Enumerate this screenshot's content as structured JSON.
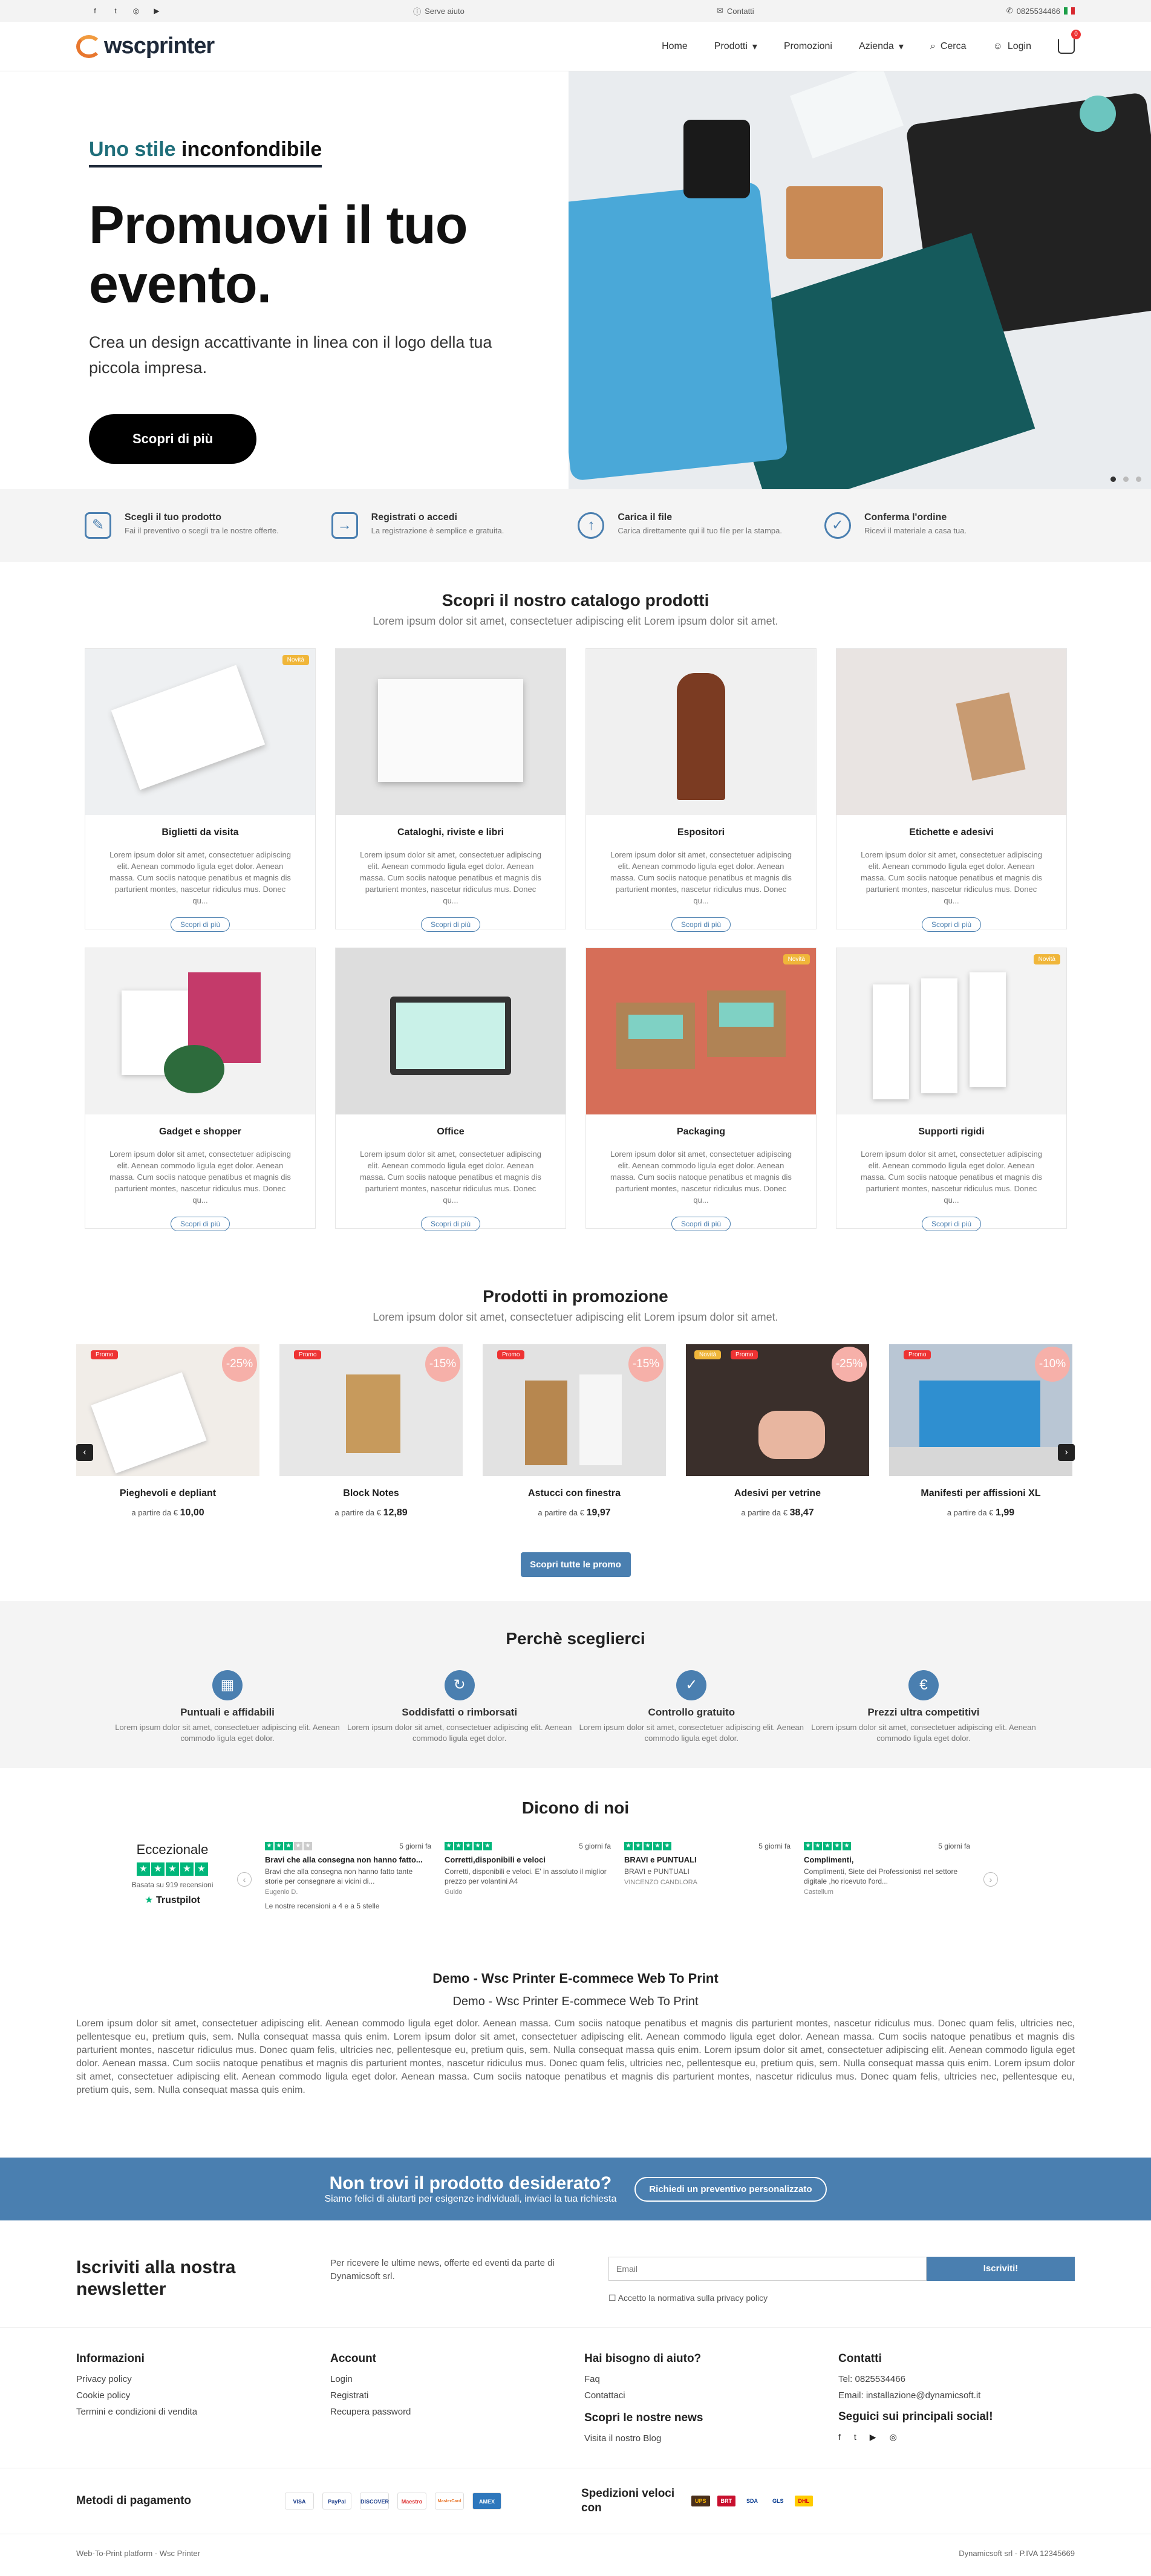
{
  "topbar": {
    "help": "Serve aiuto",
    "contacts": "Contatti",
    "phone": "0825534466"
  },
  "header": {
    "logo": "wscprinter",
    "nav": [
      "Home",
      "Prodotti",
      "Promozioni",
      "Azienda",
      "Cerca",
      "Login"
    ],
    "cart_count": "0"
  },
  "hero": {
    "kicker_1": "Uno stile",
    "kicker_2": "inconfondibile",
    "title": "Promuovi il tuo evento.",
    "text": "Crea un design accattivante in linea con il logo della tua piccola impresa.",
    "button": "Scopri di più"
  },
  "steps": [
    {
      "title": "Scegli il tuo prodotto",
      "text": "Fai il preventivo o scegli tra le nostre offerte."
    },
    {
      "title": "Registrati o accedi",
      "text": "La registrazione è semplice e gratuita."
    },
    {
      "title": "Carica il file",
      "text": "Carica direttamente qui il tuo file per la stampa."
    },
    {
      "title": "Conferma l'ordine",
      "text": "Ricevi il materiale a casa tua."
    }
  ],
  "catalog": {
    "title": "Scopri il nostro catalogo prodotti",
    "subtitle": "Lorem ipsum dolor sit amet, consectetuer adipiscing elit Lorem ipsum dolor sit amet.",
    "desc": "Lorem ipsum dolor sit amet, consectetuer adipiscing elit. Aenean commodo ligula eget dolor. Aenean massa. Cum sociis natoque penatibus et magnis dis parturient montes, nascetur ridiculus mus. Donec qu...",
    "more": "Scopri di più",
    "tag": "Novità",
    "items": [
      {
        "name": "Biglietti da visita"
      },
      {
        "name": "Cataloghi, riviste e libri"
      },
      {
        "name": "Espositori"
      },
      {
        "name": "Etichette e adesivi"
      },
      {
        "name": "Gadget e shopper"
      },
      {
        "name": "Office"
      },
      {
        "name": "Packaging"
      },
      {
        "name": "Supporti rigidi"
      }
    ]
  },
  "promo": {
    "title": "Prodotti in promozione",
    "subtitle": "Lorem ipsum dolor sit amet, consectetuer adipiscing elit Lorem ipsum dolor sit amet.",
    "price_prefix": "a partire da €",
    "promo_tag": "Promo",
    "new_tag": "Novità",
    "button": "Scopri tutte le promo",
    "items": [
      {
        "name": "Pieghevoli e depliant",
        "price": "10,00",
        "discount": "-25%"
      },
      {
        "name": "Block Notes",
        "price": "12,89",
        "discount": "-15%"
      },
      {
        "name": "Astucci con finestra",
        "price": "19,97",
        "discount": "-15%"
      },
      {
        "name": "Adesivi per vetrine",
        "price": "38,47",
        "discount": "-25%"
      },
      {
        "name": "Manifesti per affissioni XL",
        "price": "1,99",
        "discount": "-10%"
      }
    ]
  },
  "why": {
    "title": "Perchè sceglierci",
    "desc": "Lorem ipsum dolor sit amet, consectetuer adipiscing elit. Aenean commodo ligula eget dolor.",
    "items": [
      {
        "title": "Puntuali e affidabili"
      },
      {
        "title": "Soddisfatti o rimborsati"
      },
      {
        "title": "Controllo gratuito"
      },
      {
        "title": "Prezzi ultra competitivi"
      }
    ]
  },
  "reviews": {
    "title": "Dicono di noi",
    "rating": "Eccezionale",
    "based": "Basata su 919 recensioni",
    "trustpilot": "Trustpilot",
    "footer": "Le nostre recensioni a 4 e a 5 stelle",
    "items": [
      {
        "when": "5 giorni fa",
        "title": "Bravi che alla consegna non hanno fatto...",
        "body": "Bravi che alla consegna non hanno fatto tante storie per consegnare ai vicini di...",
        "author": "Eugenio D."
      },
      {
        "when": "5 giorni fa",
        "title": "Corretti,disponibili e veloci",
        "body": "Corretti, disponibili e veloci. E' in assoluto il miglior prezzo per volantini A4",
        "author": "Guido"
      },
      {
        "when": "5 giorni fa",
        "title": "BRAVI e PUNTUALI",
        "body": "BRAVI e PUNTUALI",
        "author": "VINCENZO CANDLORA"
      },
      {
        "when": "5 giorni fa",
        "title": "Complimenti,",
        "body": "Complimenti, Siete dei Professionisti nel settore digitale ,ho ricevuto l'ord...",
        "author": "Castellum"
      }
    ]
  },
  "about": {
    "title": "Demo - Wsc Printer E-commece Web To Print",
    "subtitle": "Demo - Wsc Printer E-commece Web To Print",
    "text": "Lorem ipsum dolor sit amet, consectetuer adipiscing elit. Aenean commodo ligula eget dolor. Aenean massa. Cum sociis natoque penatibus et magnis dis parturient montes, nascetur ridiculus mus. Donec quam felis, ultricies nec, pellentesque eu, pretium quis, sem. Nulla consequat massa quis enim. Lorem ipsum dolor sit amet, consectetuer adipiscing elit. Aenean commodo ligula eget dolor. Aenean massa. Cum sociis natoque penatibus et magnis dis parturient montes, nascetur ridiculus mus. Donec quam felis, ultricies nec, pellentesque eu, pretium quis, sem. Nulla consequat massa quis enim. Lorem ipsum dolor sit amet, consectetuer adipiscing elit. Aenean commodo ligula eget dolor. Aenean massa. Cum sociis natoque penatibus et magnis dis parturient montes, nascetur ridiculus mus. Donec quam felis, ultricies nec, pellentesque eu, pretium quis, sem. Nulla consequat massa quis enim. Lorem ipsum dolor sit amet, consectetuer adipiscing elit. Aenean commodo ligula eget dolor. Aenean massa. Cum sociis natoque penatibus et magnis dis parturient montes, nascetur ridiculus mus. Donec quam felis, ultricies nec, pellentesque eu, pretium quis, sem. Nulla consequat massa quis enim."
  },
  "cta": {
    "title": "Non trovi il prodotto desiderato?",
    "text": "Siamo felici di aiutarti per esigenze individuali, inviaci la tua richiesta",
    "button": "Richiedi un preventivo personalizzato"
  },
  "newsletter": {
    "title": "Iscriviti alla nostra newsletter",
    "text": "Per ricevere le ultime news, offerte ed eventi da parte di Dynamicsoft srl.",
    "placeholder": "Email",
    "button": "Iscriviti!",
    "privacy": "Accetto la normativa sulla privacy policy"
  },
  "footer": {
    "info_title": "Informazioni",
    "info_links": [
      "Privacy policy",
      "Cookie policy",
      "Termini e condizioni di vendita"
    ],
    "account_title": "Account",
    "account_links": [
      "Login",
      "Registrati",
      "Recupera password"
    ],
    "help_title": "Hai bisogno di aiuto?",
    "help_links": [
      "Faq",
      "Contattaci"
    ],
    "news_title": "Scopri le nostre news",
    "news_link": "Visita il nostro Blog",
    "contact_title": "Contatti",
    "phone": "Tel: 0825534466",
    "email": "Email: installazione@dynamicsoft.it",
    "social_title": "Seguici sui principali social!",
    "payment_title": "Metodi di pagamento",
    "payments": [
      "VISA",
      "PayPal",
      "DISCOVER",
      "Maestro",
      "MasterCard",
      "AMEX"
    ],
    "shipping_title": "Spedizioni veloci con",
    "carriers": [
      "UPS",
      "BRT",
      "SDA",
      "GLS",
      "DHL"
    ],
    "platform": "Web-To-Print platform - Wsc Printer",
    "company": "Dynamicsoft srl - P.IVA 12345669"
  }
}
